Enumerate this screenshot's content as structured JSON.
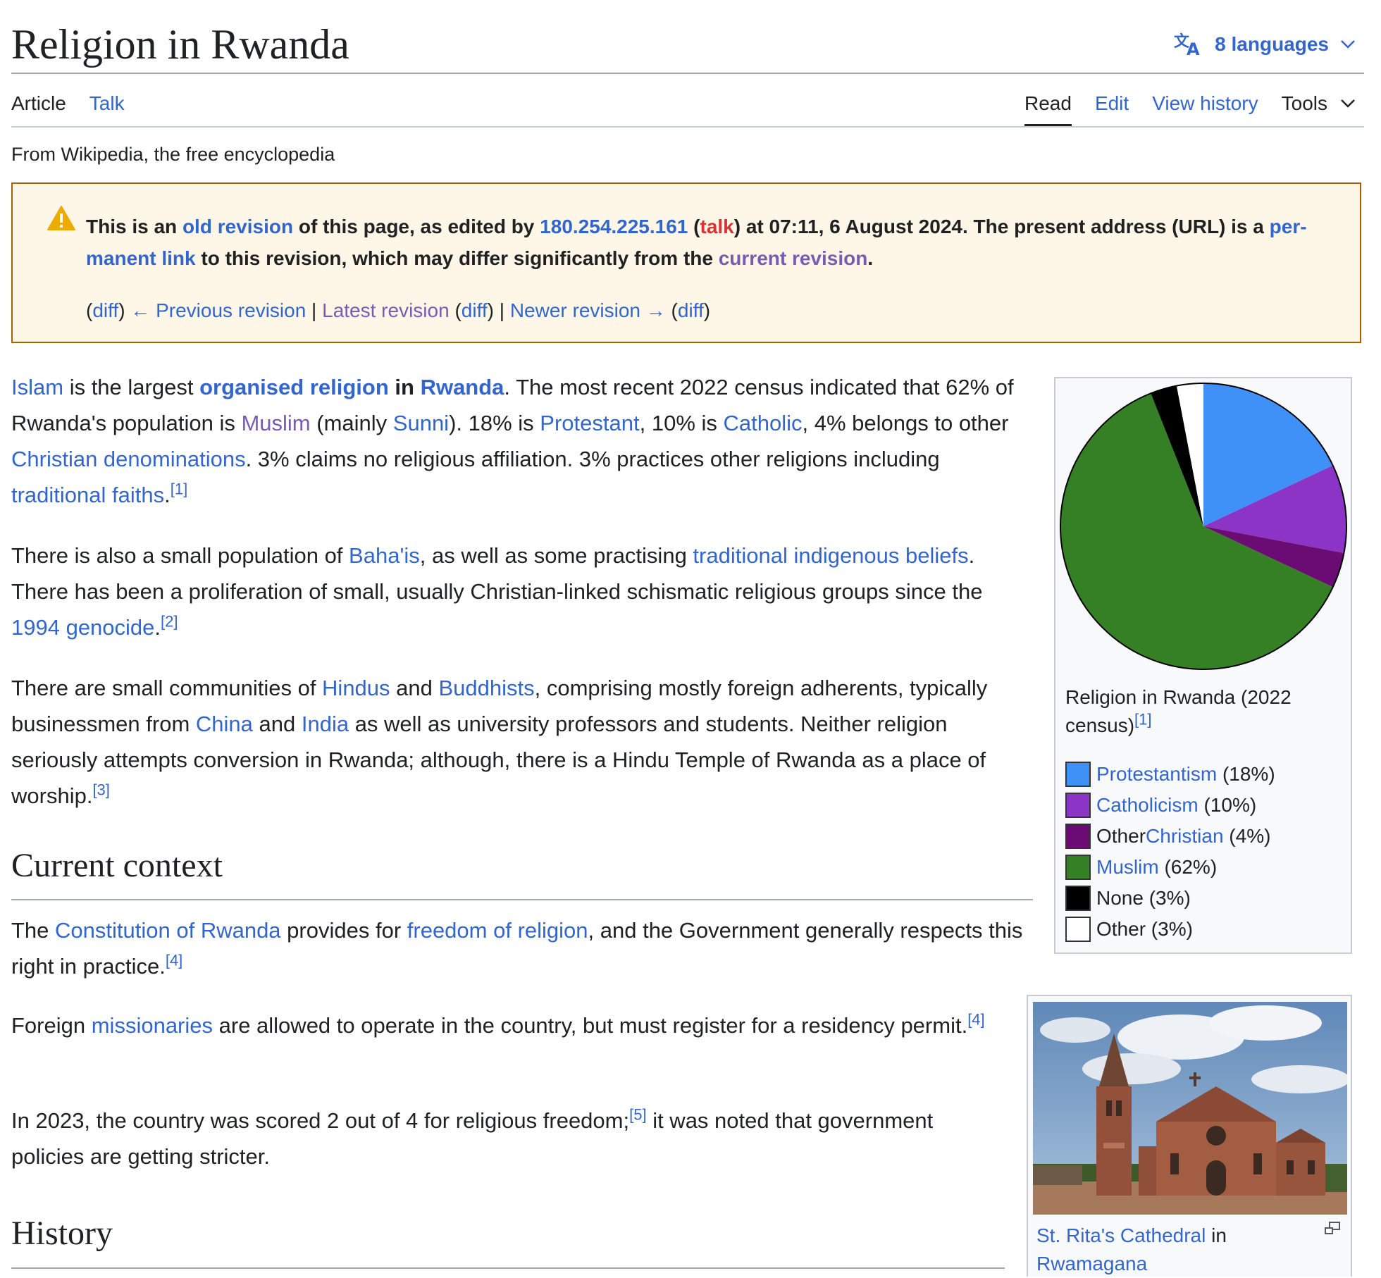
{
  "header": {
    "title": "Religion in Rwanda",
    "languages_label": "8 languages",
    "tabs_left": [
      {
        "label": "Article"
      },
      {
        "label": "Talk"
      }
    ],
    "tabs_right": [
      {
        "label": "Read"
      },
      {
        "label": "Edit"
      },
      {
        "label": "View history"
      },
      {
        "label": "Tools"
      }
    ],
    "tagline": "From Wikipedia, the free encyclopedia"
  },
  "icons": {
    "translate": "translate-icon",
    "chevron": "chevron-down-icon",
    "warning": "warning-icon",
    "enlarge": "enlarge-icon"
  },
  "colors": {
    "link": "#3366cc",
    "visited": "#795cb2",
    "redlink": "#d73333",
    "notice_bg": "#fef6e7",
    "notice_border": "#a66200",
    "warning_icon": "#edab00"
  },
  "notice": {
    "p1": "This is an ",
    "old_revision": "old revision",
    "p2": " of this page, as edited by ",
    "ip": "180.254.225.161",
    "paren_open": " (",
    "talk": "talk",
    "p3": ") at 07:11, 6 August 2024. The present address (URL) is a ",
    "permanent_link": "per­manent link",
    "p4": " to this revision, which may differ significantly from the ",
    "current_revision": "current revision",
    "p5": ".",
    "nav": {
      "paren_l": "(",
      "diff": "diff",
      "paren_r": ")",
      "previous": "← Previous revision",
      "sep": " | ",
      "latest": "Latest revision",
      "newer": "Newer revision →"
    }
  },
  "para1": {
    "islam": "Islam",
    "t1": " is the largest ",
    "organised": "organised religion",
    "in": " in ",
    "rwanda": "Rwanda",
    "t2": ". The most recent 2022 census indicated that 62% of Rwanda's population is ",
    "muslim": "Muslim",
    "t3": " (mainly ",
    "sunni": "Sunni",
    "t4": "). 18% is ",
    "protestant": "Protestant",
    "t5": ", 10% is ",
    "catholic": "Catholic",
    "t6": ", 4% belongs to other ",
    "christian": "Christian denominations",
    "t7": ". 3% claims no religious affiliation. 3% practices other religions including ",
    "traditional": "traditional faiths",
    "t8": ".",
    "ref": "[1]"
  },
  "para2": {
    "t1": "There is also a small population of ",
    "bahais": "Baha'is",
    "t2": ", as well as some practising ",
    "indigenous": "traditional indigenous beliefs",
    "t3": ". There has been a proliferation of small, usually Christian-linked schismatic religious groups since the ",
    "genocide": "1994 genocide",
    "t4": ".",
    "ref": "[2]"
  },
  "para3": {
    "t1": "There are small communities of ",
    "hindus": "Hindus",
    "and": " and ",
    "buddhists": "Buddhists",
    "t2": ", comprising mostly foreign adherents, typically businessmen from ",
    "china": "China",
    "india": "India",
    "t3": " as well as university professors and students. Neither religion seriously attempts conversion in Rwanda; although, there is a Hindu Temple of Rwanda as a place of worship.",
    "ref": "[3]"
  },
  "section_current": {
    "heading": "Current context",
    "p1": {
      "t1": "The ",
      "constitution": "Constitution of Rwanda",
      "t2": " provides for ",
      "freedom": "freedom of religion",
      "t3": ", and the Government generally respects this right in practice.",
      "ref": "[4]"
    },
    "p2": {
      "t1": "Foreign ",
      "missionaries": "missionaries",
      "t2": " are allowed to operate in the country, but must register for a residency permit.",
      "ref": "[4]"
    },
    "p3": {
      "t1": "In 2023, the country was scored 2 out of 4 for religious freedom;",
      "ref": "[5]",
      "t2": " it was noted that government policies are getting stricter."
    }
  },
  "section_history": {
    "heading": "History"
  },
  "pie_box": {
    "caption": "Religion in Rwanda (2022 census)",
    "caption_ref": "[1]",
    "legend": [
      {
        "link": "Protestantism",
        "prefix": "",
        "suffix": " (18%)"
      },
      {
        "link": "Catholicism",
        "prefix": "",
        "suffix": " (10%)"
      },
      {
        "link": "Christian",
        "prefix": "Other ",
        "suffix": " (4%)"
      },
      {
        "link": "Muslim",
        "prefix": "",
        "suffix": " (62%)"
      },
      {
        "link": "",
        "prefix": "None",
        "suffix": " (3%)"
      },
      {
        "link": "",
        "prefix": "Other",
        "suffix": " (3%)"
      }
    ]
  },
  "photo_box": {
    "caption_link1": "St. Rita's Cathedral",
    "caption_in": " in ",
    "caption_link2": "Rwamagana"
  },
  "chart_data": {
    "type": "pie",
    "categories": [
      "Protestantism",
      "Catholicism",
      "Other Christian",
      "Muslim",
      "None",
      "Other"
    ],
    "values": [
      18,
      10,
      4,
      62,
      3,
      3
    ],
    "colors": [
      "#4091f7",
      "#8c34c6",
      "#6b0c74",
      "#358024",
      "#000000",
      "#ffffff"
    ],
    "title": "Religion in Rwanda (2022 census)",
    "start_angle_deg": 0,
    "direction": "clockwise",
    "legend": "below"
  }
}
